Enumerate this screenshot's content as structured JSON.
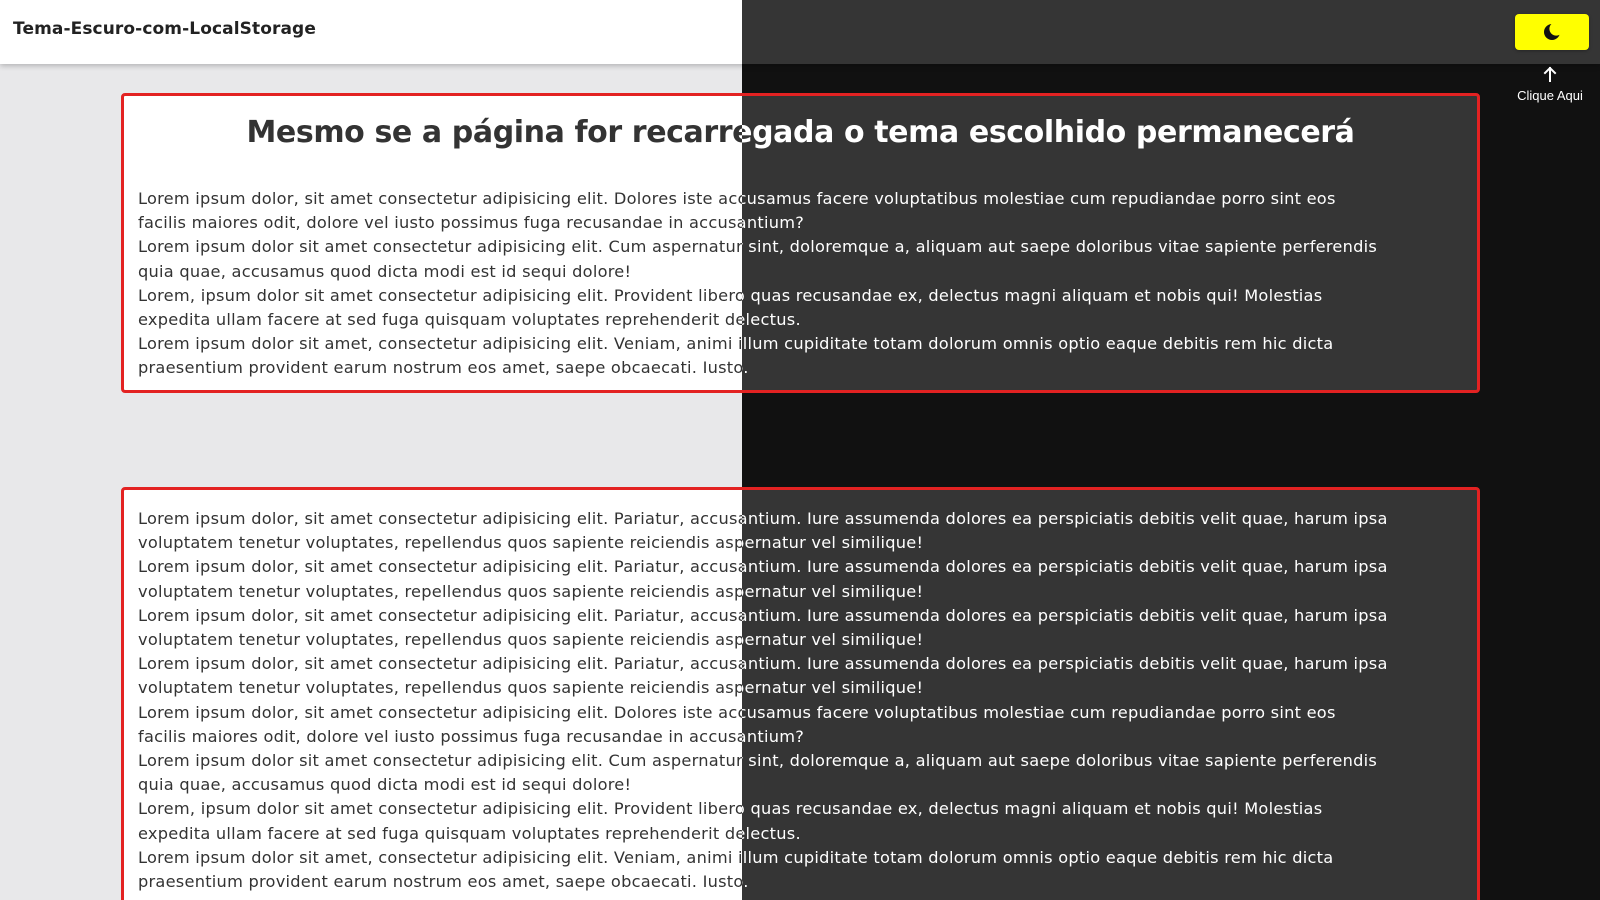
{
  "app": {
    "title": "Tema-Escuro-com-LocalStorage"
  },
  "theme_toggle": {
    "icon": "moon-icon",
    "hint_label": "Clique Aqui",
    "accent": "#ffff00"
  },
  "colors": {
    "border": "#e32222",
    "light_bg": "#e8e8ea",
    "dark_bg": "#111111",
    "dark_panel": "#353535"
  },
  "main_card": {
    "heading": "Mesmo se a página for recarregada o tema escolhido permanecerá",
    "lines": [
      "Lorem ipsum dolor, sit amet consectetur adipisicing elit. Dolores iste accusamus facere voluptatibus molestiae cum repudiandae porro sint eos",
      "facilis maiores odit, dolore vel iusto possimus fuga recusandae in accusantium?",
      "Lorem ipsum dolor sit amet consectetur adipisicing elit. Cum aspernatur sint, doloremque a, aliquam aut saepe doloribus vitae sapiente perferendis",
      "quia quae, accusamus quod dicta modi est id sequi dolore!",
      "Lorem, ipsum dolor sit amet consectetur adipisicing elit. Provident libero quas recusandae ex, delectus magni aliquam et nobis qui! Molestias",
      "expedita ullam facere at sed fuga quisquam voluptates reprehenderit delectus.",
      "Lorem ipsum dolor sit amet, consectetur adipisicing elit. Veniam, animi illum cupiditate totam dolorum omnis optio eaque debitis rem hic dicta",
      "praesentium provident earum nostrum eos amet, saepe obcaecati. Iusto."
    ]
  },
  "second_card": {
    "lines": [
      "Lorem ipsum dolor, sit amet consectetur adipisicing elit. Pariatur, accusantium. Iure assumenda dolores ea perspiciatis debitis velit quae, harum ipsa",
      "voluptatem tenetur voluptates, repellendus quos sapiente reiciendis aspernatur vel similique!",
      "Lorem ipsum dolor, sit amet consectetur adipisicing elit. Pariatur, accusantium. Iure assumenda dolores ea perspiciatis debitis velit quae, harum ipsa",
      "voluptatem tenetur voluptates, repellendus quos sapiente reiciendis aspernatur vel similique!",
      "Lorem ipsum dolor, sit amet consectetur adipisicing elit. Pariatur, accusantium. Iure assumenda dolores ea perspiciatis debitis velit quae, harum ipsa",
      "voluptatem tenetur voluptates, repellendus quos sapiente reiciendis aspernatur vel similique!",
      "Lorem ipsum dolor, sit amet consectetur adipisicing elit. Pariatur, accusantium. Iure assumenda dolores ea perspiciatis debitis velit quae, harum ipsa",
      "voluptatem tenetur voluptates, repellendus quos sapiente reiciendis aspernatur vel similique!",
      "Lorem ipsum dolor, sit amet consectetur adipisicing elit. Dolores iste accusamus facere voluptatibus molestiae cum repudiandae porro sint eos",
      "facilis maiores odit, dolore vel iusto possimus fuga recusandae in accusantium?",
      "Lorem ipsum dolor sit amet consectetur adipisicing elit. Cum aspernatur sint, doloremque a, aliquam aut saepe doloribus vitae sapiente perferendis",
      "quia quae, accusamus quod dicta modi est id sequi dolore!",
      "Lorem, ipsum dolor sit amet consectetur adipisicing elit. Provident libero quas recusandae ex, delectus magni aliquam et nobis qui! Molestias",
      "expedita ullam facere at sed fuga quisquam voluptates reprehenderit delectus.",
      "Lorem ipsum dolor sit amet, consectetur adipisicing elit. Veniam, animi illum cupiditate totam dolorum omnis optio eaque debitis rem hic dicta",
      "praesentium provident earum nostrum eos amet, saepe obcaecati. Iusto."
    ]
  }
}
